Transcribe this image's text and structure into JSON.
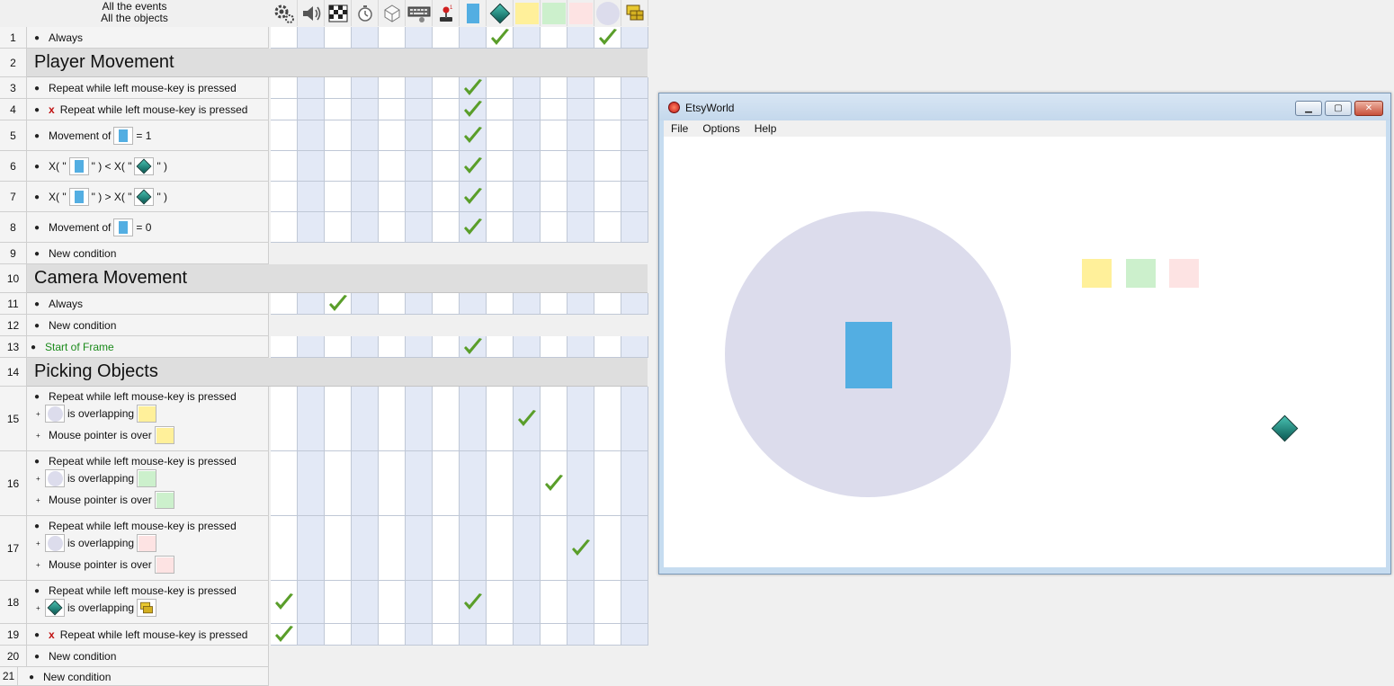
{
  "header": {
    "line1": "All the events",
    "line2": "All the objects",
    "columns": [
      {
        "icon": "gear-icon"
      },
      {
        "icon": "speaker-icon"
      },
      {
        "icon": "checkered-flag-icon"
      },
      {
        "icon": "timer-icon"
      },
      {
        "icon": "cube-icon"
      },
      {
        "icon": "keyboard-icon"
      },
      {
        "icon": "joystick-icon"
      },
      {
        "icon": "blue-rectangle-object",
        "color": "#53aee2"
      },
      {
        "icon": "teal-gem-object",
        "color": "#1f8c86"
      },
      {
        "icon": "yellow-square-object",
        "color": "#fff09a"
      },
      {
        "icon": "green-square-object",
        "color": "#ccf0cc"
      },
      {
        "icon": "pink-square-object",
        "color": "#fde3e3"
      },
      {
        "icon": "lavender-circle-object",
        "color": "#dcdcec"
      },
      {
        "icon": "tiled-sprite-object",
        "color": "#d4b020"
      }
    ]
  },
  "groups": {
    "player": "Player Movement",
    "camera": "Camera Movement",
    "picking": "Picking Objects"
  },
  "rows": {
    "r1": {
      "num": "1",
      "text": "Always"
    },
    "r2": {
      "num": "2"
    },
    "r3": {
      "num": "3",
      "text": "Repeat while left mouse-key is pressed"
    },
    "r4": {
      "num": "4",
      "text": "Repeat while left mouse-key is pressed",
      "mark": "x"
    },
    "r5": {
      "num": "5",
      "pre": "Movement of",
      "post": "= 1"
    },
    "r6": {
      "num": "6",
      "a": "X( \"",
      "b": "\" ) < X( \"",
      "c": "\" )"
    },
    "r7": {
      "num": "7",
      "a": "X( \"",
      "b": "\" ) > X( \"",
      "c": "\" )"
    },
    "r8": {
      "num": "8",
      "pre": "Movement of",
      "post": "= 0"
    },
    "r9": {
      "num": "9",
      "text": "New condition"
    },
    "r10": {
      "num": "10"
    },
    "r11": {
      "num": "11",
      "text": "Always"
    },
    "r12": {
      "num": "12",
      "text": "New condition"
    },
    "r13": {
      "num": "13",
      "text": "Start of Frame"
    },
    "r14": {
      "num": "14"
    },
    "r15": {
      "num": "15",
      "l1": "Repeat while left mouse-key is pressed",
      "l2": "is overlapping",
      "l3": "Mouse pointer is over"
    },
    "r16": {
      "num": "16",
      "l1": "Repeat while left mouse-key is pressed",
      "l2": "is overlapping",
      "l3": "Mouse pointer is over"
    },
    "r17": {
      "num": "17",
      "l1": "Repeat while left mouse-key is pressed",
      "l2": "is overlapping",
      "l3": "Mouse pointer is over"
    },
    "r18": {
      "num": "18",
      "l1": "Repeat while left mouse-key is pressed",
      "l2": "is overlapping"
    },
    "r19": {
      "num": "19",
      "text": "Repeat while left mouse-key is pressed",
      "mark": "x"
    },
    "r20": {
      "num": "20",
      "text": "New condition"
    },
    "r21": {
      "num": "21",
      "text": "New condition"
    }
  },
  "window": {
    "title": "EtsyWorld",
    "menu": [
      "File",
      "Options",
      "Help"
    ],
    "scene_colors": {
      "circle": "#dcdcec",
      "player": "#53aee2",
      "yellow": "#fff09a",
      "green": "#ccf0cc",
      "pink": "#fde3e3"
    }
  },
  "colors": {
    "check_green": "#5a9e2a",
    "grid_alt": "#e3e9f6",
    "group_band": "#dedede",
    "start_of_frame_text": "#1a8a1a"
  }
}
